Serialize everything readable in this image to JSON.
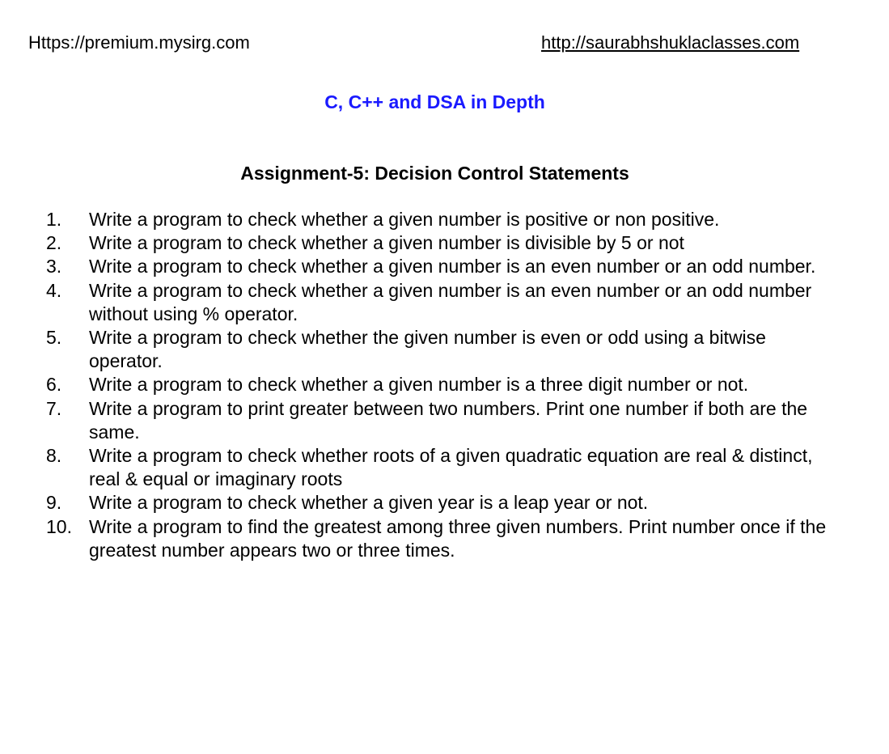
{
  "header": {
    "left_url": "Https://premium.mysirg.com",
    "right_url": "http://saurabhshuklaclasses.com"
  },
  "course_title": "C, C++ and DSA in Depth",
  "assignment_title": "Assignment-5: Decision Control Statements",
  "title_color": "#1a1aff",
  "questions": [
    {
      "number": "1.",
      "text": "Write a program to check whether a given number is positive or non positive."
    },
    {
      "number": "2.",
      "text": "Write a program to check whether a given number is divisible by 5 or not"
    },
    {
      "number": "3.",
      "text": "Write a program to check whether a given number is an even number or an odd number."
    },
    {
      "number": "4.",
      "text": "Write a program to check whether a given number is an even number or an odd number without using % operator."
    },
    {
      "number": "5.",
      "text": "Write a program to check whether the given number is even or odd using a bitwise operator."
    },
    {
      "number": "6.",
      "text": "Write a program to check whether a given number is a three digit number or not."
    },
    {
      "number": "7.",
      "text": "Write a program to print greater between two numbers. Print one number if both are the same."
    },
    {
      "number": "8.",
      "text": "Write a program to check whether roots of a given quadratic equation are real & distinct, real & equal or imaginary roots"
    },
    {
      "number": "9.",
      "text": "Write a program to check whether a given year is a leap year or not."
    },
    {
      "number": "10.",
      "text": "Write a program to find the greatest among three given numbers. Print number once if the greatest number appears two or three times."
    }
  ]
}
